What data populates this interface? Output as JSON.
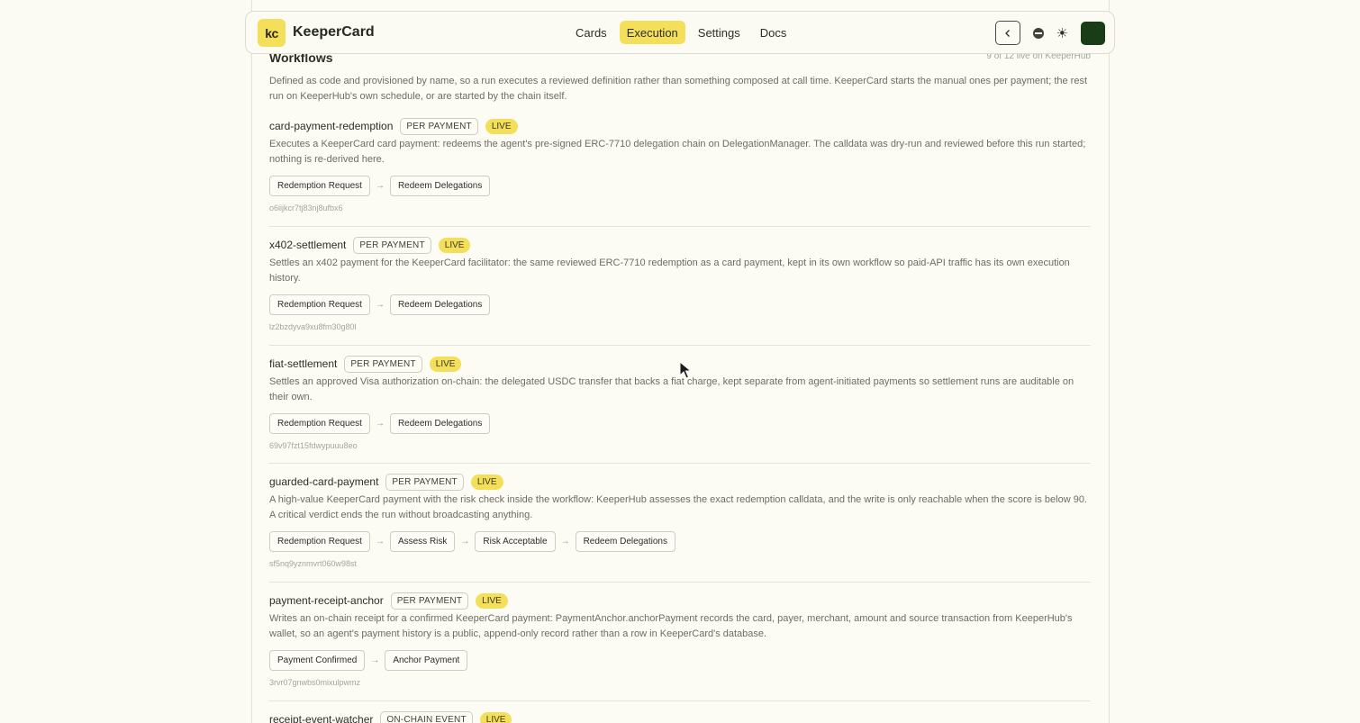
{
  "header": {
    "logo_text": "kc",
    "brand": "KeeperCard",
    "nav": [
      {
        "label": "Cards",
        "active": false
      },
      {
        "label": "Execution",
        "active": true
      },
      {
        "label": "Settings",
        "active": false
      },
      {
        "label": "Docs",
        "active": false
      }
    ],
    "back_icon": "chevron-left-icon",
    "theme_dark_icon": "moon-icon",
    "theme_light_icon": "sun-icon",
    "accent_color": "#f4df5a"
  },
  "section": {
    "title": "Workflows",
    "count": "9 of 12 live on KeeperHub",
    "intro": "Defined as code and provisioned by name, so a run executes a reviewed definition rather than something composed at call time. KeeperCard starts the manual ones per payment; the rest run on KeeperHub's own schedule, or are started by the chain itself."
  },
  "workflows": [
    {
      "name": "card-payment-redemption",
      "trigger": "PER PAYMENT",
      "status": "LIVE",
      "description": "Executes a KeeperCard card payment: redeems the agent's pre-signed ERC-7710 delegation chain on DelegationManager. The calldata was dry-run and reviewed before this run started; nothing is re-derived here.",
      "steps": [
        "Redemption Request",
        "Redeem Delegations"
      ],
      "id": "o6iijkcr7tj83nj8ufbx6"
    },
    {
      "name": "x402-settlement",
      "trigger": "PER PAYMENT",
      "status": "LIVE",
      "description": "Settles an x402 payment for the KeeperCard facilitator: the same reviewed ERC-7710 redemption as a card payment, kept in its own workflow so paid-API traffic has its own execution history.",
      "steps": [
        "Redemption Request",
        "Redeem Delegations"
      ],
      "id": "lz2bzdyva9xu8fm30g80l"
    },
    {
      "name": "fiat-settlement",
      "trigger": "PER PAYMENT",
      "status": "LIVE",
      "description": "Settles an approved Visa authorization on-chain: the delegated USDC transfer that backs a fiat charge, kept separate from agent-initiated payments so settlement runs are auditable on their own.",
      "steps": [
        "Redemption Request",
        "Redeem Delegations"
      ],
      "id": "69v97fzt15fdwypuuu8eo"
    },
    {
      "name": "guarded-card-payment",
      "trigger": "PER PAYMENT",
      "status": "LIVE",
      "description": "A high-value KeeperCard payment with the risk check inside the workflow: KeeperHub assesses the exact redemption calldata, and the write is only reachable when the score is below 90. A critical verdict ends the run without broadcasting anything.",
      "steps": [
        "Redemption Request",
        "Assess Risk",
        "Risk Acceptable",
        "Redeem Delegations"
      ],
      "id": "sf5nq9yznmvrt060w98st"
    },
    {
      "name": "payment-receipt-anchor",
      "trigger": "PER PAYMENT",
      "status": "LIVE",
      "description": "Writes an on-chain receipt for a confirmed KeeperCard payment: PaymentAnchor.anchorPayment records the card, payer, merchant, amount and source transaction from KeeperHub's wallet, so an agent's payment history is a public, append-only record rather than a row in KeeperCard's database.",
      "steps": [
        "Payment Confirmed",
        "Anchor Payment"
      ],
      "id": "3rvr07gnwbs0mixulpwmz"
    },
    {
      "name": "receipt-event-watcher",
      "trigger": "ON-CHAIN EVENT",
      "status": "LIVE",
      "description": "",
      "steps": [],
      "id": ""
    }
  ]
}
